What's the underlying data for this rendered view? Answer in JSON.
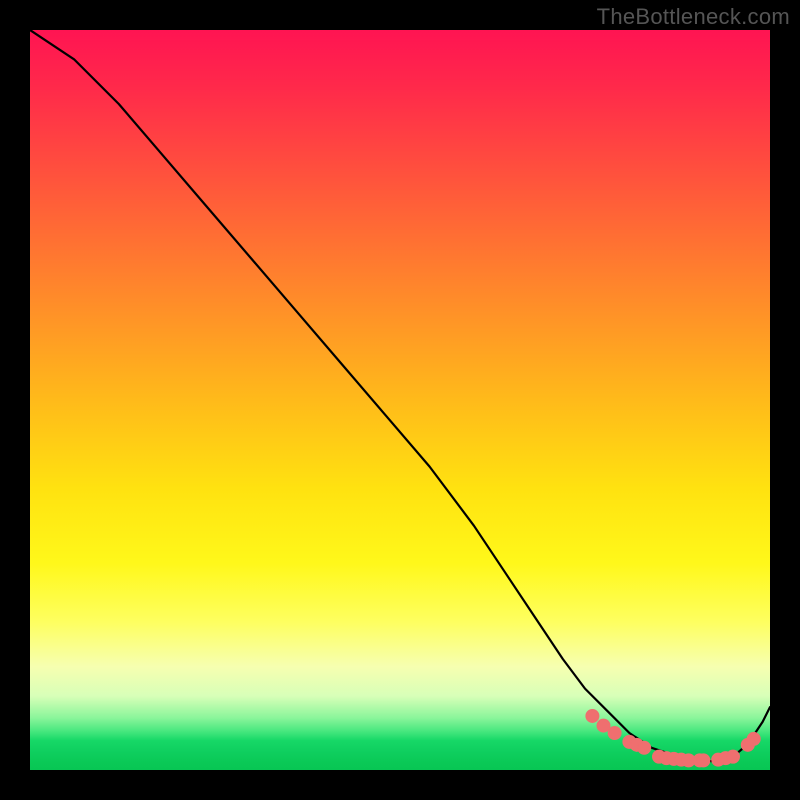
{
  "watermark": "TheBottleneck.com",
  "colors": {
    "curve_stroke": "#000000",
    "marker_fill": "#ef6f6f",
    "marker_stroke": "#ef6f6f"
  },
  "chart_data": {
    "type": "line",
    "title": "",
    "xlabel": "",
    "ylabel": "",
    "xlim": [
      0,
      100
    ],
    "ylim": [
      0,
      100
    ],
    "grid": false,
    "legend": false,
    "series": [
      {
        "name": "curve",
        "x": [
          0,
          6,
          12,
          18,
          24,
          30,
          36,
          42,
          48,
          54,
          60,
          64,
          68,
          72,
          75,
          78,
          81,
          84,
          87,
          89,
          91,
          93,
          95,
          97,
          99,
          100
        ],
        "values": [
          100,
          96,
          90,
          83,
          76,
          69,
          62,
          55,
          48,
          41,
          33,
          27,
          21,
          15,
          11,
          8,
          5,
          3,
          2,
          1.5,
          1.2,
          1.2,
          1.8,
          3.5,
          6.5,
          8.5
        ]
      }
    ],
    "markers": [
      {
        "x": 76.0,
        "y": 7.3
      },
      {
        "x": 77.5,
        "y": 6.0
      },
      {
        "x": 79.0,
        "y": 5.0
      },
      {
        "x": 81.0,
        "y": 3.8
      },
      {
        "x": 82.0,
        "y": 3.4
      },
      {
        "x": 83.0,
        "y": 3.0
      },
      {
        "x": 85.0,
        "y": 1.8
      },
      {
        "x": 86.0,
        "y": 1.6
      },
      {
        "x": 87.0,
        "y": 1.5
      },
      {
        "x": 88.0,
        "y": 1.4
      },
      {
        "x": 89.0,
        "y": 1.3
      },
      {
        "x": 90.5,
        "y": 1.3
      },
      {
        "x": 91.0,
        "y": 1.3
      },
      {
        "x": 93.0,
        "y": 1.4
      },
      {
        "x": 94.0,
        "y": 1.6
      },
      {
        "x": 95.0,
        "y": 1.8
      },
      {
        "x": 97.0,
        "y": 3.4
      },
      {
        "x": 97.8,
        "y": 4.2
      }
    ]
  }
}
